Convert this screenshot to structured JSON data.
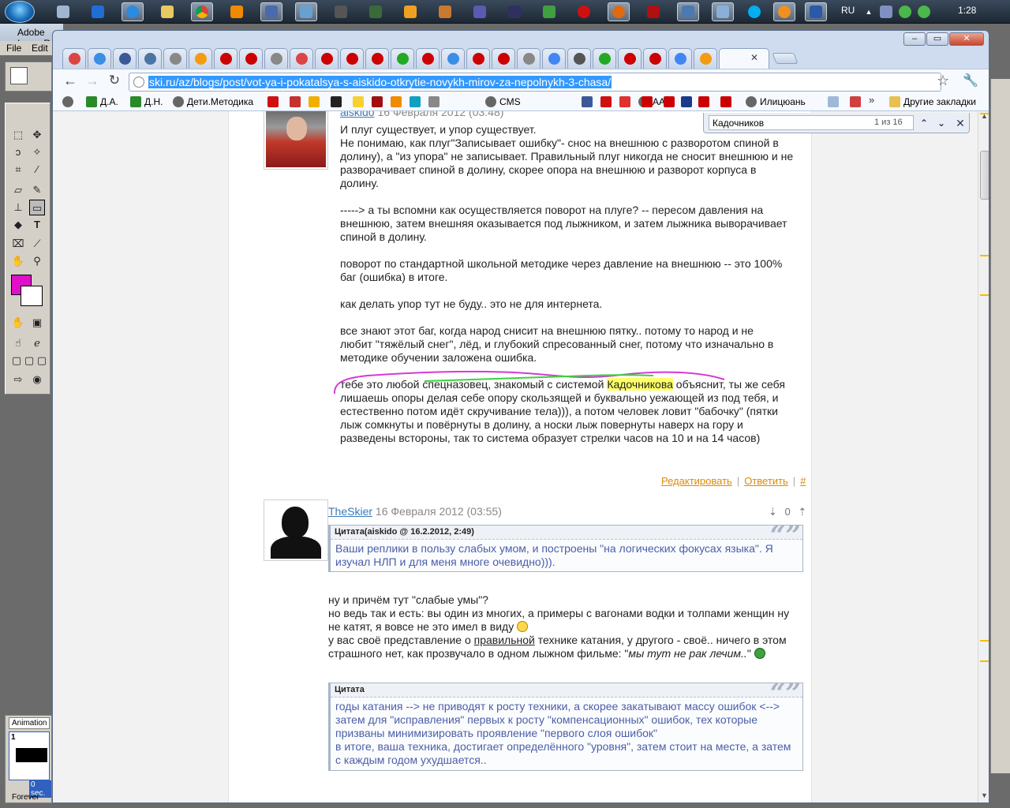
{
  "taskbar": {
    "lang": "RU",
    "clock": "1:28"
  },
  "imageready": {
    "title": "Adobe ImageReady",
    "menu_file": "File",
    "menu_edit": "Edit",
    "animation_tab": "Animation",
    "frame_number": "1",
    "frame_delay": "0 sec.",
    "loop": "Forever",
    "colors": {
      "foreground": "#e010c8",
      "background": "#ffffff"
    }
  },
  "browser": {
    "url": "ski.ru/az/blogs/post/vot-ya-i-pokatalsya-s-aiskido-otkrytie-novykh-mirov-za-nepolnykh-3-chasa/",
    "bookmarks": [
      {
        "label": "",
        "icon": "globe-icon"
      },
      {
        "label": "Д.А.",
        "icon": "grid-icon"
      },
      {
        "label": "Д.Н.",
        "icon": "grid-icon"
      },
      {
        "label": "Дети.Методика",
        "icon": "globe-icon"
      },
      {
        "label": "CMS",
        "icon": "globe-icon"
      },
      {
        "label": "AA",
        "icon": "globe-icon"
      },
      {
        "label": "Илицюань",
        "icon": "globe-icon"
      },
      {
        "label": "Другие закладки",
        "icon": "folder-icon"
      }
    ],
    "find": {
      "query": "Кадочников",
      "count": "1 из 16"
    }
  },
  "post1": {
    "author": "aiskido",
    "date": "16 Февраля 2012 (03:48)",
    "lines": [
      "И плуг существует, и упор существует.",
      "Не понимаю, как плуг\"Записывает ошибку\"- снос на внешнюю с разворотом спиной в",
      "долину), а \"из упора\" не записывает. Правильный плуг никогда не сносит внешнюю и не",
      "разворачивает спиной в долину, скорее опора на внешнюю и разворот корпуса в",
      "долину.",
      "",
      "-----> а ты вспомни как осуществляется поворот на плуге? -- пересом давления на",
      "внешнюю, затем внешняя оказывается под лыжником, и затем лыжника выворачивает",
      "спиной в долину.",
      "",
      "поворот по стандартной школьной методике через давление на внешнюю -- это 100%",
      "баг (ошибка) в итоге.",
      "",
      "как делать упор тут не буду.. это не для интернета.",
      "",
      "все знают этот баг, когда народ снисит на внешнюю пятку.. потому то народ и не",
      "любит \"тяжёлый снег\", лёд, и глубокий спресованный снег, потому что изначально в",
      "методике обучении заложена ошибка.",
      ""
    ],
    "highlight_pre": "тебе это любой спецназовец, знакомый с системой ",
    "highlight_word": "Кадочникова",
    "highlight_post": " объяснит, ты  же себя",
    "lines_after": [
      "лишаешь опоры делая себе опору скользящей и буквально уежающей из под тебя, и",
      "естественно потом идёт скручивание тела))), а потом человек ловит \"бабочку\" (пятки",
      "лыж сомкнуты и повёрнуты в долину, а носки лыж повернуты наверх  на гору и",
      "разведены встороны, так то система образует стрелки часов на 10 и на 14 часов)"
    ],
    "edit_label": "Редактировать",
    "reply_label": "Ответить",
    "hash_label": "#"
  },
  "post2": {
    "author": "TheSkier",
    "date": "16 Февраля 2012 (03:55)",
    "votes": "0",
    "quote1_head": "Цитата(aiskido @ 16.2.2012, 2:49)",
    "quote1_lines": [
      "Ваши реплики в пользу слабых умом, и построены \"на логических фокусах языка\". Я",
      "изучал НЛП и для меня многе очевидно)))."
    ],
    "body_line1": "ну и причём тут \"слабые умы\"?",
    "body_line2": "но ведь так и есть: вы один из многих, а примеры с вагонами водки и толпами женщин ну",
    "body_line3": "не катят, я вовсе не это имел в виду",
    "body_line4_pre": "у вас своё представление о ",
    "body_line4_link": "правильной",
    "body_line4_post": " технике катания, у другого - своё.. ничего в этом",
    "body_line5_pre": "страшного нет, как прозвучало в одном лыжном фильме: \"",
    "body_line5_it": "мы тут не рак лечим..",
    "body_line5_post": "\"",
    "quote2_head": "Цитата",
    "quote2_lines": [
      "годы катания --> не приводят к росту техники, а скорее закатывают массу ошибок <-->",
      "затем для \"исправления\" первых к росту \"компенсационных\" ошибок, тех которые",
      "призваны минимизировать проявление \"первого слоя ошибок\"",
      "в итоге, ваша техника, достигает определённого \"уровня\", затем стоит на месте, а затем",
      "с каждым годом ухудшается.."
    ]
  },
  "annotation_colors": {
    "magenta": "#d63ad6",
    "green": "#3ad63a",
    "highlight": "#ffff66",
    "link": "#3a7ab8",
    "action": "#e08a00"
  }
}
